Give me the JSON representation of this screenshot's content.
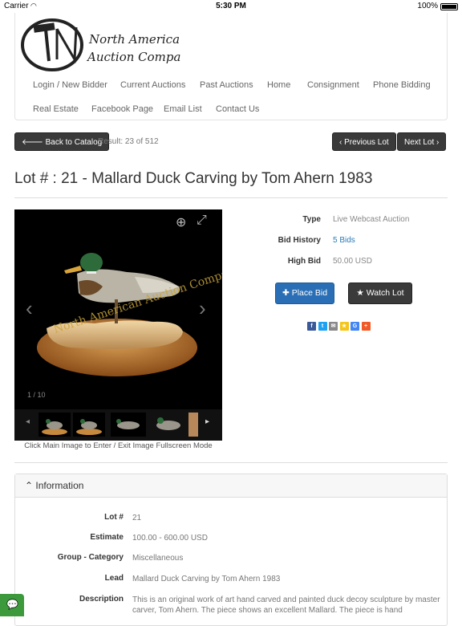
{
  "status_bar": {
    "carrier": "Carrier",
    "time": "5:30 PM",
    "battery": "100%"
  },
  "brand": {
    "line1": "North American",
    "line2": "Auction Company"
  },
  "nav": {
    "items": [
      {
        "label": "Login / New Bidder"
      },
      {
        "label": "Current Auctions"
      },
      {
        "label": "Past Auctions"
      },
      {
        "label": "Home"
      },
      {
        "label": "Consignment"
      },
      {
        "label": "Phone Bidding"
      },
      {
        "label": "Real Estate"
      },
      {
        "label": "Facebook Page"
      },
      {
        "label": "Email List"
      },
      {
        "label": "Contact Us"
      }
    ]
  },
  "toolbar": {
    "back_label": "Back to Catalog",
    "result_text": "Result: 23 of 512",
    "prev_label": "Previous Lot",
    "next_label": "Next Lot"
  },
  "lot": {
    "title": "Lot # : 21 - Mallard Duck Carving by Tom Ahern 1983"
  },
  "gallery": {
    "watermark": "North American Auction Company",
    "counter": "1 / 10",
    "caption": "Click Main Image to Enter / Exit Image Fullscreen Mode"
  },
  "details": {
    "type_label": "Type",
    "type_value": "Live Webcast Auction",
    "history_label": "Bid History",
    "history_value": "5 Bids",
    "highbid_label": "High Bid",
    "highbid_value": "50.00 USD"
  },
  "actions": {
    "place_bid": "Place Bid",
    "watch_lot": "Watch Lot"
  },
  "share": {
    "icons": [
      {
        "name": "facebook-share-icon",
        "glyph": "f",
        "color": "#3b5998"
      },
      {
        "name": "twitter-share-icon",
        "glyph": "t",
        "color": "#1da1f2"
      },
      {
        "name": "email-share-icon",
        "glyph": "✉",
        "color": "#888888"
      },
      {
        "name": "favorite-share-icon",
        "glyph": "★",
        "color": "#f5c518"
      },
      {
        "name": "google-share-icon",
        "glyph": "G",
        "color": "#4285f4"
      },
      {
        "name": "more-share-icon",
        "glyph": "+",
        "color": "#f05a28"
      }
    ]
  },
  "information": {
    "heading": "Information",
    "rows": [
      {
        "label": "Lot #",
        "value": "21"
      },
      {
        "label": "Estimate",
        "value": "100.00 - 600.00 USD"
      },
      {
        "label": "Group - Category",
        "value": "Miscellaneous"
      },
      {
        "label": "Lead",
        "value": "Mallard Duck Carving by Tom Ahern 1983"
      },
      {
        "label": "Description",
        "value": "This is an original work of art hand carved and painted duck decoy sculpture by master carver, Tom Ahern. The piece shows an excellent Mallard. The piece is hand"
      }
    ]
  },
  "colors": {
    "primary": "#2a6fb5",
    "dark_button": "#3a3a3a",
    "link": "#2a7ab7",
    "chat": "#3c9a3c"
  }
}
